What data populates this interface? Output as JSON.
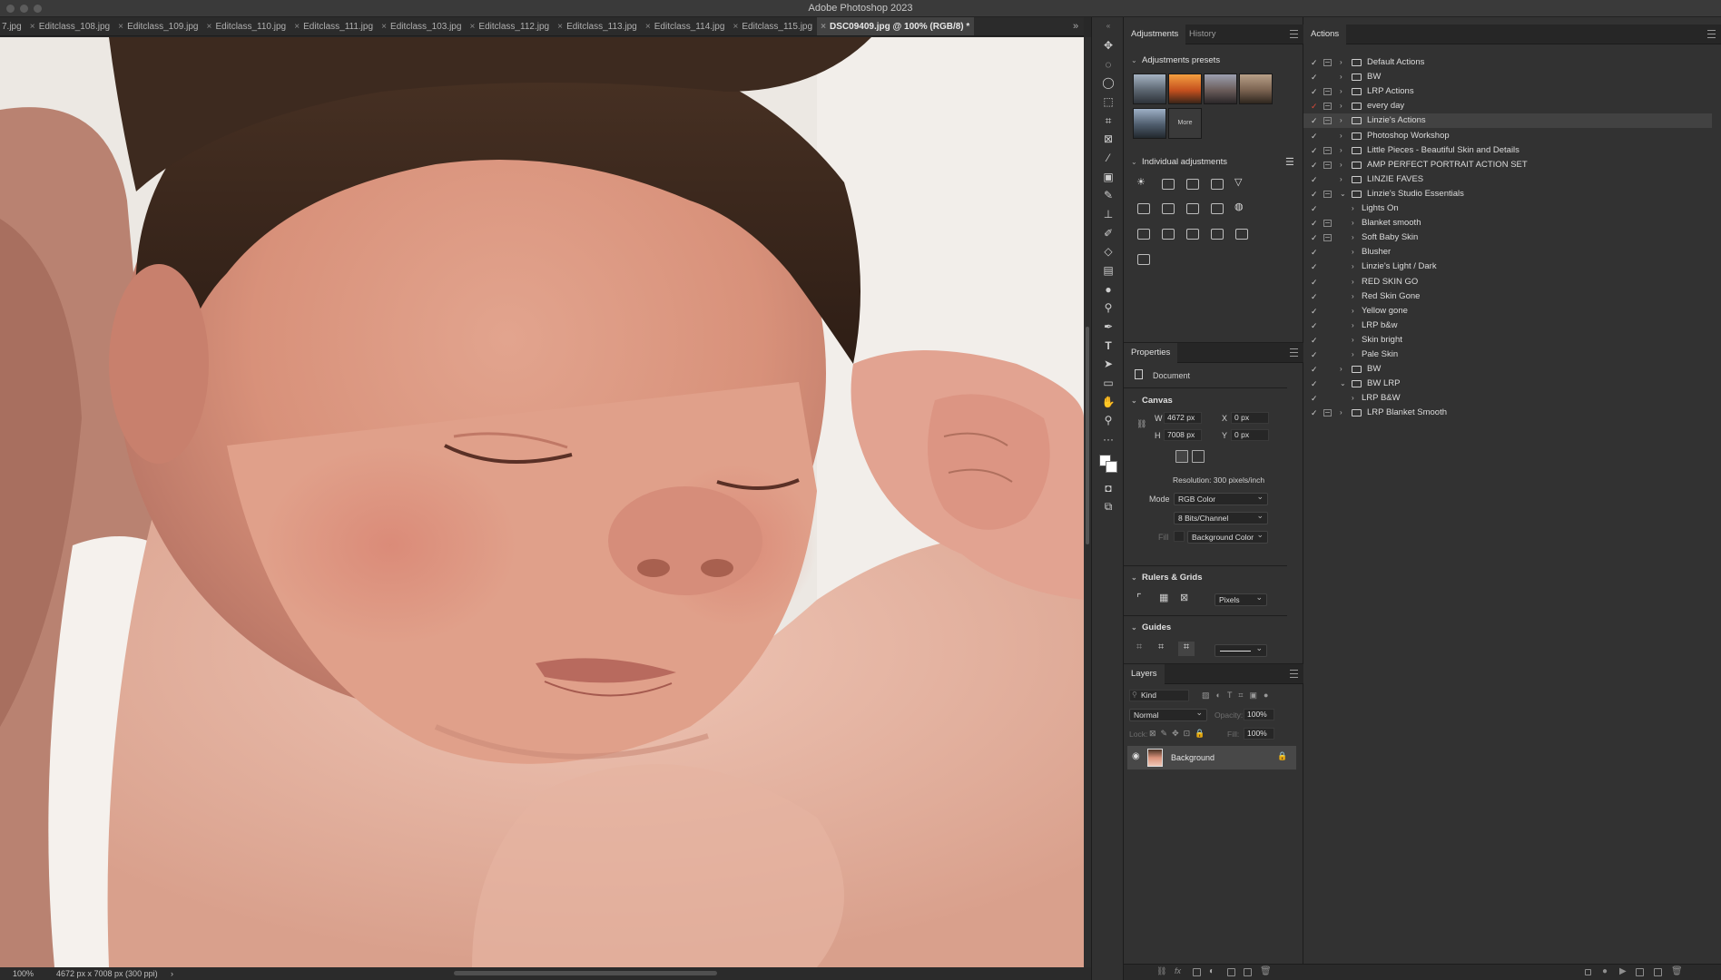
{
  "app": {
    "title": "Adobe Photoshop 2023"
  },
  "tabs": [
    {
      "label": "7.jpg"
    },
    {
      "label": "Editclass_108.jpg"
    },
    {
      "label": "Editclass_109.jpg"
    },
    {
      "label": "Editclass_110.jpg"
    },
    {
      "label": "Editclass_111.jpg"
    },
    {
      "label": "Editclass_103.jpg"
    },
    {
      "label": "Editclass_112.jpg"
    },
    {
      "label": "Editclass_113.jpg"
    },
    {
      "label": "Editclass_114.jpg"
    },
    {
      "label": "Editclass_115.jpg"
    },
    {
      "label": "DSC09409.jpg @ 100% (RGB/8) *",
      "active": true
    }
  ],
  "tab_overflow": "»",
  "status": {
    "zoom": "100%",
    "doc_info": "4672 px x 7008 px (300 ppi)",
    "arrow": "›"
  },
  "adjustments_panel": {
    "tabs": [
      "Adjustments",
      "History"
    ],
    "presets_title": "Adjustments presets",
    "presets_more": "More",
    "individual_title": "Individual adjustments"
  },
  "properties": {
    "title": "Properties",
    "doc_label": "Document",
    "canvas_title": "Canvas",
    "w_label": "W",
    "w_value": "4672 px",
    "h_label": "H",
    "h_value": "7008 px",
    "x_label": "X",
    "x_value": "0 px",
    "y_label": "Y",
    "y_value": "0 px",
    "resolution": "Resolution: 300 pixels/inch",
    "mode_label": "Mode",
    "mode_value": "RGB Color",
    "bits_value": "8 Bits/Channel",
    "fill_label": "Fill",
    "fill_value": "Background Color",
    "rulers_title": "Rulers & Grids",
    "units_value": "Pixels",
    "guides_title": "Guides"
  },
  "layers": {
    "title": "Layers",
    "search_placeholder": "Kind",
    "blend_mode": "Normal",
    "opacity_label": "Opacity:",
    "opacity_value": "100%",
    "lock_label": "Lock:",
    "fill_label": "Fill:",
    "fill_value": "100%",
    "items": [
      {
        "name": "Background"
      }
    ]
  },
  "actions_panel": {
    "title": "Actions",
    "items": [
      {
        "name": "Default Actions",
        "level": 0,
        "folder": true,
        "dialog": true,
        "expanded": false
      },
      {
        "name": "BW",
        "level": 0,
        "folder": true,
        "dialog": false,
        "expanded": false
      },
      {
        "name": "LRP Actions",
        "level": 0,
        "folder": true,
        "dialog": true,
        "expanded": false
      },
      {
        "name": "every day",
        "level": 0,
        "folder": true,
        "dialog": true,
        "expanded": false,
        "red_check": true
      },
      {
        "name": "Linzie's Actions",
        "level": 0,
        "folder": true,
        "dialog": true,
        "expanded": false,
        "selected": true
      },
      {
        "name": "Photoshop Workshop",
        "level": 0,
        "folder": true,
        "dialog": false,
        "expanded": false
      },
      {
        "name": "Little Pieces - Beautiful Skin and Details",
        "level": 0,
        "folder": true,
        "dialog": true,
        "expanded": false
      },
      {
        "name": "AMP PERFECT PORTRAIT ACTION SET",
        "level": 0,
        "folder": true,
        "dialog": true,
        "expanded": false
      },
      {
        "name": "LINZIE FAVES",
        "level": 0,
        "folder": true,
        "dialog": false,
        "expanded": false
      },
      {
        "name": "Linzie's Studio Essentials",
        "level": 0,
        "folder": true,
        "dialog": true,
        "expanded": true
      },
      {
        "name": "Lights On",
        "level": 1,
        "folder": false,
        "dialog": false
      },
      {
        "name": "Blanket smooth",
        "level": 1,
        "folder": false,
        "dialog": true
      },
      {
        "name": "Soft Baby Skin",
        "level": 1,
        "folder": false,
        "dialog": true
      },
      {
        "name": "Blusher",
        "level": 1,
        "folder": false,
        "dialog": false
      },
      {
        "name": "Linzie's Light / Dark",
        "level": 1,
        "folder": false,
        "dialog": false
      },
      {
        "name": "RED SKIN GO",
        "level": 1,
        "folder": false,
        "dialog": false
      },
      {
        "name": "Red Skin Gone",
        "level": 1,
        "folder": false,
        "dialog": false
      },
      {
        "name": "Yellow gone",
        "level": 1,
        "folder": false,
        "dialog": false
      },
      {
        "name": "LRP b&w",
        "level": 1,
        "folder": false,
        "dialog": false
      },
      {
        "name": "Skin bright",
        "level": 1,
        "folder": false,
        "dialog": false
      },
      {
        "name": "Pale Skin",
        "level": 1,
        "folder": false,
        "dialog": false
      },
      {
        "name": "BW",
        "level": 0,
        "folder": true,
        "dialog": false,
        "expanded": false
      },
      {
        "name": "BW LRP",
        "level": 0,
        "folder": true,
        "dialog": false,
        "expanded": true
      },
      {
        "name": "LRP B&W",
        "level": 1,
        "folder": false,
        "dialog": false
      },
      {
        "name": "LRP Blanket Smooth",
        "level": 0,
        "folder": true,
        "dialog": true,
        "expanded": false
      }
    ]
  }
}
